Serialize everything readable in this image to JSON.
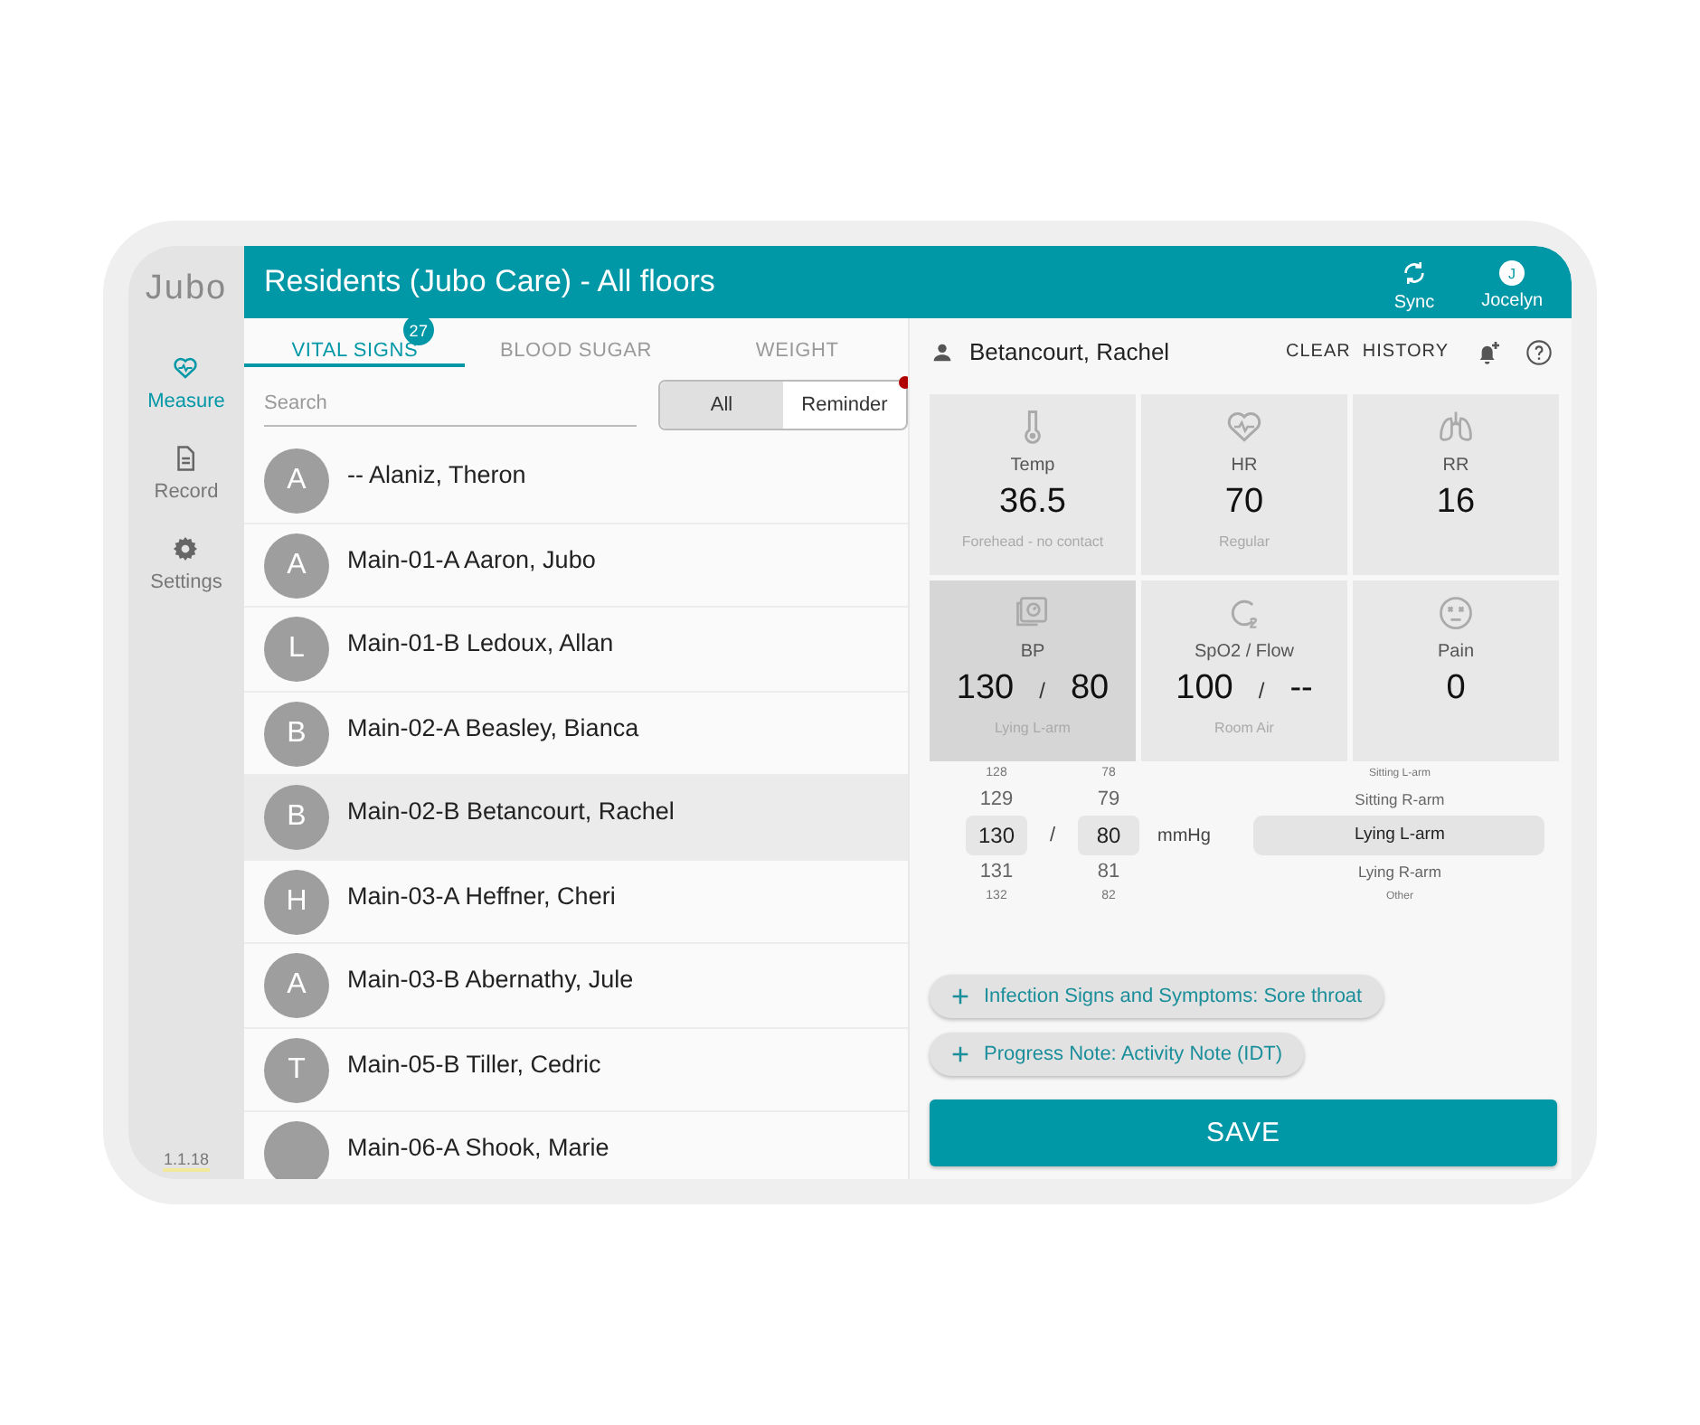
{
  "app": {
    "logo": "Jubo",
    "version": "1.1.18"
  },
  "sidebar": {
    "items": [
      {
        "kind": "heart",
        "label": "Measure",
        "selected": true
      },
      {
        "kind": "document",
        "label": "Record",
        "selected": false
      },
      {
        "kind": "gear",
        "label": "Settings",
        "selected": false
      }
    ]
  },
  "header": {
    "title": "Residents (Jubo Care) - All floors",
    "actions": [
      {
        "kind": "sync",
        "label": "Sync"
      },
      {
        "kind": "user",
        "label": "Jocelyn",
        "initial": "J"
      }
    ]
  },
  "tabs": [
    {
      "label": "VITAL SIGNS",
      "selected": true,
      "badge": "27"
    },
    {
      "label": "BLOOD SUGAR",
      "selected": false
    },
    {
      "label": "WEIGHT",
      "selected": false
    }
  ],
  "search": {
    "placeholder": "Search"
  },
  "filter": [
    {
      "label": "All",
      "selected": true,
      "alert": false
    },
    {
      "label": "Reminder",
      "selected": false,
      "alert": true
    }
  ],
  "residents": [
    {
      "initial": "A",
      "name": "-- Alaniz, Theron",
      "selected": false
    },
    {
      "initial": "A",
      "name": "Main-01-A Aaron, Jubo",
      "selected": false
    },
    {
      "initial": "L",
      "name": "Main-01-B Ledoux, Allan",
      "selected": false
    },
    {
      "initial": "B",
      "name": "Main-02-A Beasley, Bianca",
      "selected": false
    },
    {
      "initial": "B",
      "name": "Main-02-B Betancourt, Rachel",
      "selected": true
    },
    {
      "initial": "H",
      "name": "Main-03-A Heffner, Cheri",
      "selected": false
    },
    {
      "initial": "A",
      "name": "Main-03-B Abernathy, Jule",
      "selected": false
    },
    {
      "initial": "T",
      "name": "Main-05-B Tiller, Cedric",
      "selected": false
    },
    {
      "name": "Main-06-A Shook, Marie",
      "selected": false
    }
  ],
  "detail": {
    "resident": "Betancourt, Rachel",
    "clear_button": "CLEAR  HISTORY"
  },
  "vitals": [
    {
      "kind": "temp",
      "label": "Temp",
      "values": [
        "36.5"
      ],
      "note": "Forehead - no contact",
      "selected": false
    },
    {
      "kind": "hr",
      "label": "HR",
      "values": [
        "70"
      ],
      "note": "Regular",
      "selected": false
    },
    {
      "kind": "rr",
      "label": "RR",
      "values": [
        "16"
      ],
      "selected": false
    },
    {
      "kind": "bp",
      "label": "BP",
      "values": [
        "130",
        "80"
      ],
      "separator": "/",
      "note": "Lying L-arm",
      "selected": true
    },
    {
      "kind": "spo2",
      "label": "SpO2 / Flow",
      "values": [
        "100",
        "--"
      ],
      "separator": "/",
      "note": "Room Air",
      "selected": false
    },
    {
      "kind": "pain",
      "label": "Pain",
      "values": [
        "0"
      ],
      "selected": false
    }
  ],
  "picker": {
    "systolic": [
      {
        "value": "128",
        "selected": false
      },
      {
        "value": "129",
        "selected": false
      },
      {
        "value": "130",
        "selected": true
      },
      {
        "value": "131",
        "selected": false
      },
      {
        "value": "132",
        "selected": false
      }
    ],
    "separator": "/",
    "diastolic": [
      {
        "value": "78",
        "selected": false
      },
      {
        "value": "79",
        "selected": false
      },
      {
        "value": "80",
        "selected": true
      },
      {
        "value": "81",
        "selected": false
      },
      {
        "value": "82",
        "selected": false
      }
    ],
    "unit": "mmHg",
    "positions": [
      {
        "label": "Sitting L-arm",
        "selected": false
      },
      {
        "label": "Sitting R-arm",
        "selected": false
      },
      {
        "label": "Lying L-arm",
        "selected": true
      },
      {
        "label": "Lying R-arm",
        "selected": false
      },
      {
        "label": "Other",
        "selected": false
      }
    ]
  },
  "chips": [
    {
      "label": "Infection Signs and Symptoms: Sore throat"
    },
    {
      "label": "Progress Note: Activity Note (IDT)"
    }
  ],
  "save_button": "SAVE"
}
